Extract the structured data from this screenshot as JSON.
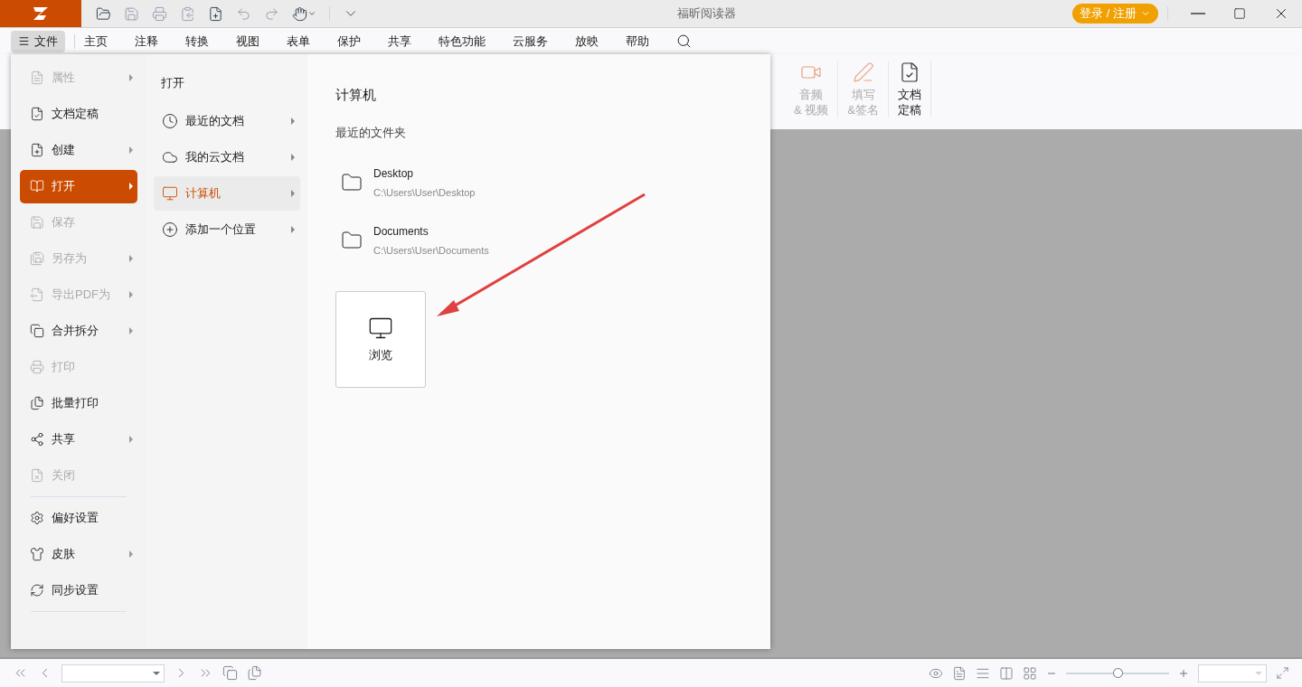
{
  "title_bar": {
    "title": "福昕阅读器",
    "login_button": "登录 / 注册"
  },
  "menu_bar": {
    "file_button": "文件",
    "items": [
      {
        "label": "主页",
        "selected": false
      },
      {
        "label": "注释",
        "selected": false
      },
      {
        "label": "转换",
        "selected": false
      },
      {
        "label": "视图",
        "selected": false
      },
      {
        "label": "表单",
        "selected": false
      },
      {
        "label": "保护",
        "selected": false
      },
      {
        "label": "共享",
        "selected": false
      },
      {
        "label": "特色功能",
        "selected": false
      },
      {
        "label": "云服务",
        "selected": false
      },
      {
        "label": "放映",
        "selected": false
      },
      {
        "label": "帮助",
        "selected": false
      }
    ]
  },
  "ribbon": {
    "items": [
      {
        "lines": [
          "音频",
          "& 视频"
        ],
        "disabled": true
      },
      {
        "lines": [
          "填写",
          "&签名"
        ],
        "disabled": true
      },
      {
        "lines": [
          "文档",
          "定稿"
        ],
        "disabled": false
      }
    ]
  },
  "file_menu": {
    "sections": [
      [
        {
          "label": "属性",
          "disabled": true,
          "submenu": true,
          "selected": false
        },
        {
          "label": "文档定稿",
          "disabled": false,
          "submenu": false,
          "selected": false
        },
        {
          "label": "创建",
          "disabled": false,
          "submenu": true,
          "selected": false
        },
        {
          "label": "打开",
          "disabled": false,
          "submenu": true,
          "selected": true
        },
        {
          "label": "保存",
          "disabled": true,
          "submenu": false,
          "selected": false
        },
        {
          "label": "另存为",
          "disabled": true,
          "submenu": true,
          "selected": false
        },
        {
          "label": "导出PDF为",
          "disabled": true,
          "submenu": true,
          "selected": false
        },
        {
          "label": "合并拆分",
          "disabled": false,
          "submenu": true,
          "selected": false
        },
        {
          "label": "打印",
          "disabled": true,
          "submenu": false,
          "selected": false
        },
        {
          "label": "批量打印",
          "disabled": false,
          "submenu": false,
          "selected": false
        },
        {
          "label": "共享",
          "disabled": false,
          "submenu": true,
          "selected": false
        },
        {
          "label": "关闭",
          "disabled": true,
          "submenu": false,
          "selected": false
        }
      ],
      [
        {
          "label": "偏好设置",
          "disabled": false,
          "submenu": false,
          "selected": false
        },
        {
          "label": "皮肤",
          "disabled": false,
          "submenu": true,
          "selected": false
        },
        {
          "label": "同步设置",
          "disabled": false,
          "submenu": false,
          "selected": false
        }
      ]
    ],
    "open_panel": {
      "heading": "打开",
      "items": [
        {
          "label": "最近的文档",
          "selected": false
        },
        {
          "label": "我的云文档",
          "selected": false
        },
        {
          "label": "计算机",
          "selected": true
        },
        {
          "label": "添加一个位置",
          "selected": false
        }
      ]
    },
    "computer_panel": {
      "heading": "计算机",
      "subheading": "最近的文件夹",
      "folders": [
        {
          "name": "Desktop",
          "path": "C:\\Users\\User\\Desktop"
        },
        {
          "name": "Documents",
          "path": "C:\\Users\\User\\Documents"
        }
      ],
      "browse_button": "浏览"
    }
  },
  "status_bar": {
    "zoom_slider": {
      "level": 0.5
    }
  }
}
